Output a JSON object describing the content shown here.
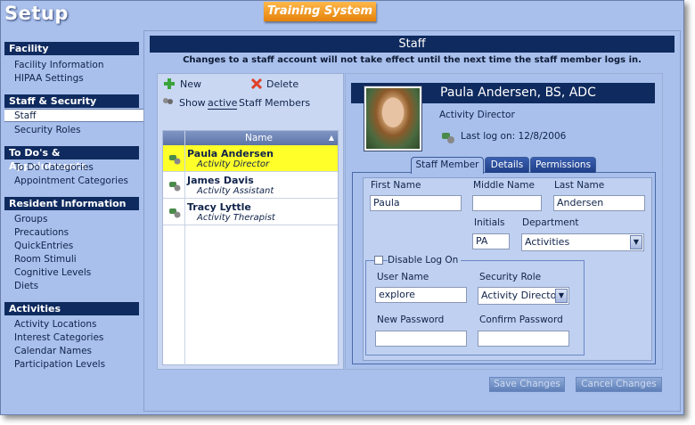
{
  "app": {
    "title": "Setup",
    "badge": "Training System"
  },
  "sidebar": {
    "sections": [
      {
        "label": "Facility",
        "items": [
          "Facility Information",
          "HIPAA Settings"
        ]
      },
      {
        "label": "Staff & Security",
        "items": [
          "Staff",
          "Security Roles"
        ]
      },
      {
        "label": "To Do's & Appointments",
        "items": [
          "To Do Categories",
          "Appointment Categories"
        ]
      },
      {
        "label": "Resident Information",
        "items": [
          "Groups",
          "Precautions",
          "QuickEntries",
          "Room Stimuli",
          "Cognitive Levels",
          "Diets"
        ]
      },
      {
        "label": "Activities",
        "items": [
          "Activity Locations",
          "Interest Categories",
          "Calendar Names",
          "Participation Levels"
        ]
      }
    ],
    "selected": "Staff"
  },
  "page": {
    "title": "Staff",
    "notice": "Changes to a staff account will not take effect until the next time the staff member logs in."
  },
  "toolbar": {
    "new": "New",
    "delete": "Delete",
    "show_prefix": "Show",
    "show_filter": "active",
    "show_suffix": "Staff Members"
  },
  "list": {
    "column": "Name",
    "rows": [
      {
        "name": "Paula Andersen",
        "role": "Activity Director"
      },
      {
        "name": "James Davis",
        "role": "Activity Assistant"
      },
      {
        "name": "Tracy Lyttle",
        "role": "Activity Therapist"
      }
    ]
  },
  "detail": {
    "name": "Paula Andersen, BS, ADC",
    "title": "Activity Director",
    "last_logon": "Last log on: 12/8/2006"
  },
  "tabs": [
    "Staff Member",
    "Details",
    "Permissions"
  ],
  "form": {
    "first_name_label": "First Name",
    "first_name": "Paula",
    "middle_name_label": "Middle Name",
    "middle_name": "",
    "last_name_label": "Last Name",
    "last_name": "Andersen",
    "initials_label": "Initials",
    "initials": "PA",
    "department_label": "Department",
    "department": "Activities",
    "disable_label": "Disable Log On",
    "username_label": "User Name",
    "username": "explore",
    "role_label": "Security Role",
    "role": "Activity Director",
    "new_pw_label": "New Password",
    "confirm_pw_label": "Confirm Password"
  },
  "buttons": {
    "save": "Save Changes",
    "cancel": "Cancel Changes"
  },
  "colors": {
    "accent": "#0f2a5e",
    "background": "#a9c0ec",
    "highlight": "#ffff29",
    "badge": "#f09a20"
  }
}
